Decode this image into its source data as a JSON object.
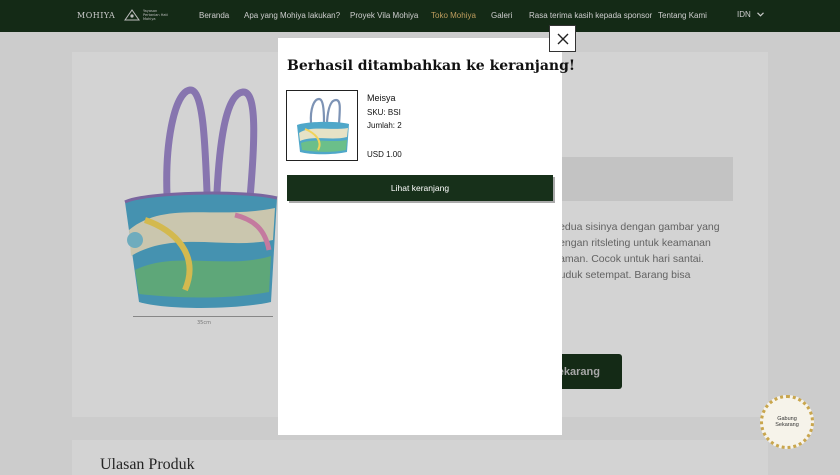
{
  "nav": {
    "logo": "MOHIYA",
    "sub_logo_text": "Yayasan Pertanian Hati Mohiya",
    "items": [
      {
        "label": "Beranda"
      },
      {
        "label": "Apa yang Mohiya lakukan?"
      },
      {
        "label": "Proyek Vila Mohiya"
      },
      {
        "label": "Toko Mohiya"
      },
      {
        "label": "Galeri"
      },
      {
        "label": "Rasa terima kasih kepada sponsor"
      },
      {
        "label": "Tentang Kami"
      }
    ],
    "active_index": 3,
    "language": "IDN"
  },
  "product_page": {
    "dimension_label": "35cm",
    "description_lines": [
      "t kedua sisinya dengan gambar yang",
      "i dengan ritsleting untuk keamanan",
      "nyaman. Cocok untuk hari santai.",
      "nduduk setempat. Barang bisa"
    ],
    "buy_button_label": "ekarang",
    "reviews_heading": "Ulasan Produk"
  },
  "join_badge": {
    "line1": "Gabung",
    "line2": "Sekarang"
  },
  "modal": {
    "title": "Berhasil ditambahkan ke keranjang!",
    "product_name": "Meisya",
    "sku": "SKU: BSI",
    "quantity": "Jumlah: 2",
    "price": "USD 1.00",
    "view_cart_label": "Lihat keranjang"
  },
  "colors": {
    "brand_green": "#17301a",
    "active_nav": "#d8b26a",
    "badge_gold": "#c9a64d"
  }
}
